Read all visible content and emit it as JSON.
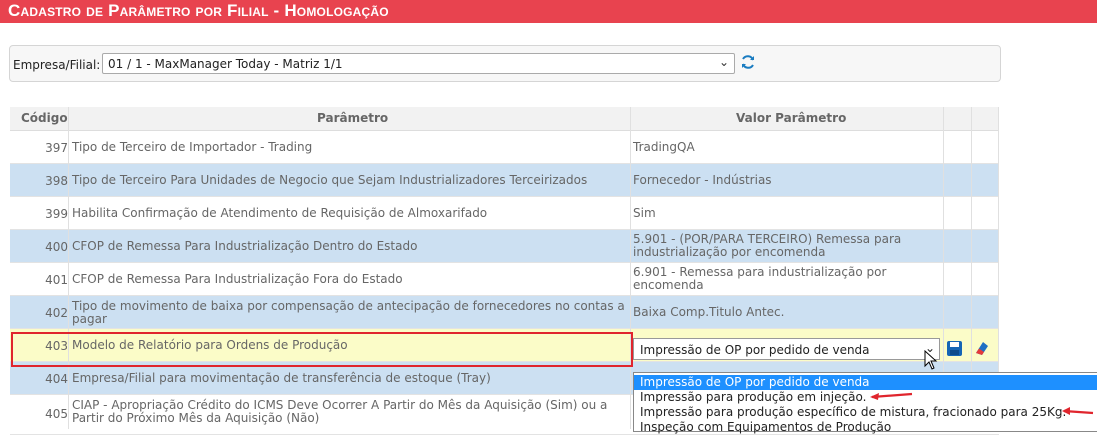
{
  "title": "Cadastro de Parâmetro por Filial  - Homologação",
  "filter": {
    "label": "Empresa/Filial:",
    "selected": "01 / 1 - MaxManager Today - Matriz 1/1"
  },
  "grid": {
    "headers": [
      "Código",
      "Parâmetro",
      "Valor Parâmetro"
    ],
    "rows": [
      {
        "code": "397",
        "param": "Tipo de Terceiro de Importador - Trading",
        "value": "TradingQA"
      },
      {
        "code": "398",
        "param": "Tipo de Terceiro Para Unidades de Negocio que Sejam Industrializadores Terceirizados",
        "value": "Fornecedor - Indústrias"
      },
      {
        "code": "399",
        "param": "Habilita Confirmação de Atendimento de Requisição de Almoxarifado",
        "value": "Sim"
      },
      {
        "code": "400",
        "param": "CFOP de Remessa Para Industrialização Dentro do Estado",
        "value": "5.901 - (POR/PARA TERCEIRO) Remessa para industrialização por encomenda"
      },
      {
        "code": "401",
        "param": "CFOP de Remessa Para Industrialização Fora do Estado",
        "value": "6.901 - Remessa para industrialização por encomenda"
      },
      {
        "code": "402",
        "param": "Tipo de movimento de baixa por compensação de antecipação de fornecedores no contas a pagar",
        "value": "Baixa Comp.Titulo Antec."
      },
      {
        "code": "403",
        "param": "Modelo de Relatório para Ordens de Produção",
        "value": "Impressão de OP por pedido de venda"
      },
      {
        "code": "404",
        "param": "Empresa/Filial para movimentação de transferência de estoque (Tray)",
        "value": ""
      },
      {
        "code": "405",
        "param": "CIAP - Apropriação Crédito do ICMS Deve Ocorrer A Partir do Mês da Aquisição (Sim) ou a Partir do Próximo Mês da Aquisição (Não)",
        "value": ""
      }
    ]
  },
  "dropdown": {
    "options": [
      "Impressão de OP por pedido de venda",
      "Impressão para produção em injeção.",
      "Impressão para produção específico de mistura, fracionado para 25Kg.",
      "Inspeção com Equipamentos de Produção"
    ]
  },
  "colors": {
    "header": "#e8434f",
    "alt_row": "#cce0f2",
    "selected_row": "#fbfcc8",
    "highlight": "#1e90ff",
    "annotation": "#e0252d"
  },
  "icons": [
    "refresh-icon",
    "save-icon",
    "eraser-icon",
    "chevron-down-icon",
    "mouse-cursor-icon",
    "red-arrow-icon"
  ]
}
